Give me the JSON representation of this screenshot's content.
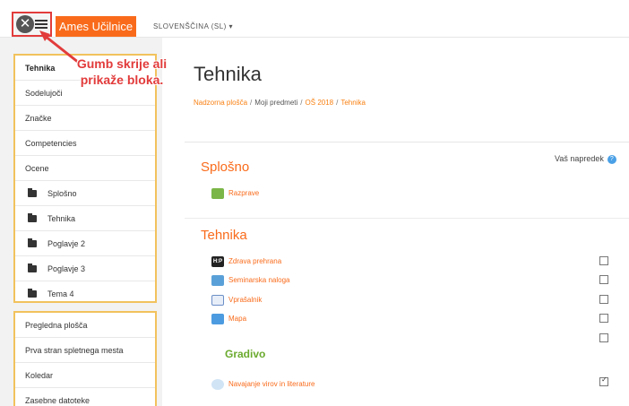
{
  "navbar": {
    "brand": "Ames Učilnice",
    "language": "SLOVENŠČINA (SL) ▾",
    "toggle_icon": "close-icon"
  },
  "drawer": {
    "nav_items": [
      {
        "label": "Tehnika",
        "active": true
      },
      {
        "label": "Sodelujoči"
      },
      {
        "label": "Značke"
      },
      {
        "label": "Competencies"
      },
      {
        "label": "Ocene"
      },
      {
        "label": "Splošno",
        "icon": "folder-icon"
      },
      {
        "label": "Tehnika",
        "icon": "folder-icon"
      },
      {
        "label": "Poglavje 2",
        "icon": "folder-icon"
      },
      {
        "label": "Poglavje 3",
        "icon": "folder-icon"
      },
      {
        "label": "Tema 4",
        "icon": "folder-icon"
      }
    ],
    "site_items": [
      {
        "label": "Pregledna plošča"
      },
      {
        "label": "Prva stran spletnega mesta"
      },
      {
        "label": "Koledar"
      },
      {
        "label": "Zasebne datoteke"
      }
    ]
  },
  "callout": {
    "line1": "Gumb skrije ali",
    "line2": "prikaže bloka."
  },
  "header": {
    "title": "Tehnika",
    "breadcrumb": [
      "Nadzorna plošča",
      "Moji predmeti",
      "OŠ 2018",
      "Tehnika"
    ]
  },
  "content": {
    "progress_label": "Vaš napredek",
    "sections": [
      {
        "title": "Splošno"
      },
      {
        "title": "Tehnika"
      }
    ],
    "activities": [
      {
        "label": "Razprave",
        "icon": "forum-icon"
      },
      {
        "label": "Zdrava prehrana",
        "icon": "hp-icon",
        "icon_text": "H:P",
        "completed": false
      },
      {
        "label": "Seminarska naloga",
        "icon": "assignment-icon",
        "completed": false
      },
      {
        "label": "Vprašalnik",
        "icon": "quiz-icon",
        "completed": false
      },
      {
        "label": "Mapa",
        "icon": "folder-icon",
        "completed": false
      },
      {
        "label": "Navajanje virov in literature",
        "icon": "url-icon",
        "completed": true
      }
    ],
    "label_text": "Gradivo"
  },
  "colors": {
    "brand": "#f96b1b",
    "highlight_border": "#f2c25d",
    "callout": "#e23b3b",
    "label_green": "#6aaa2e"
  }
}
